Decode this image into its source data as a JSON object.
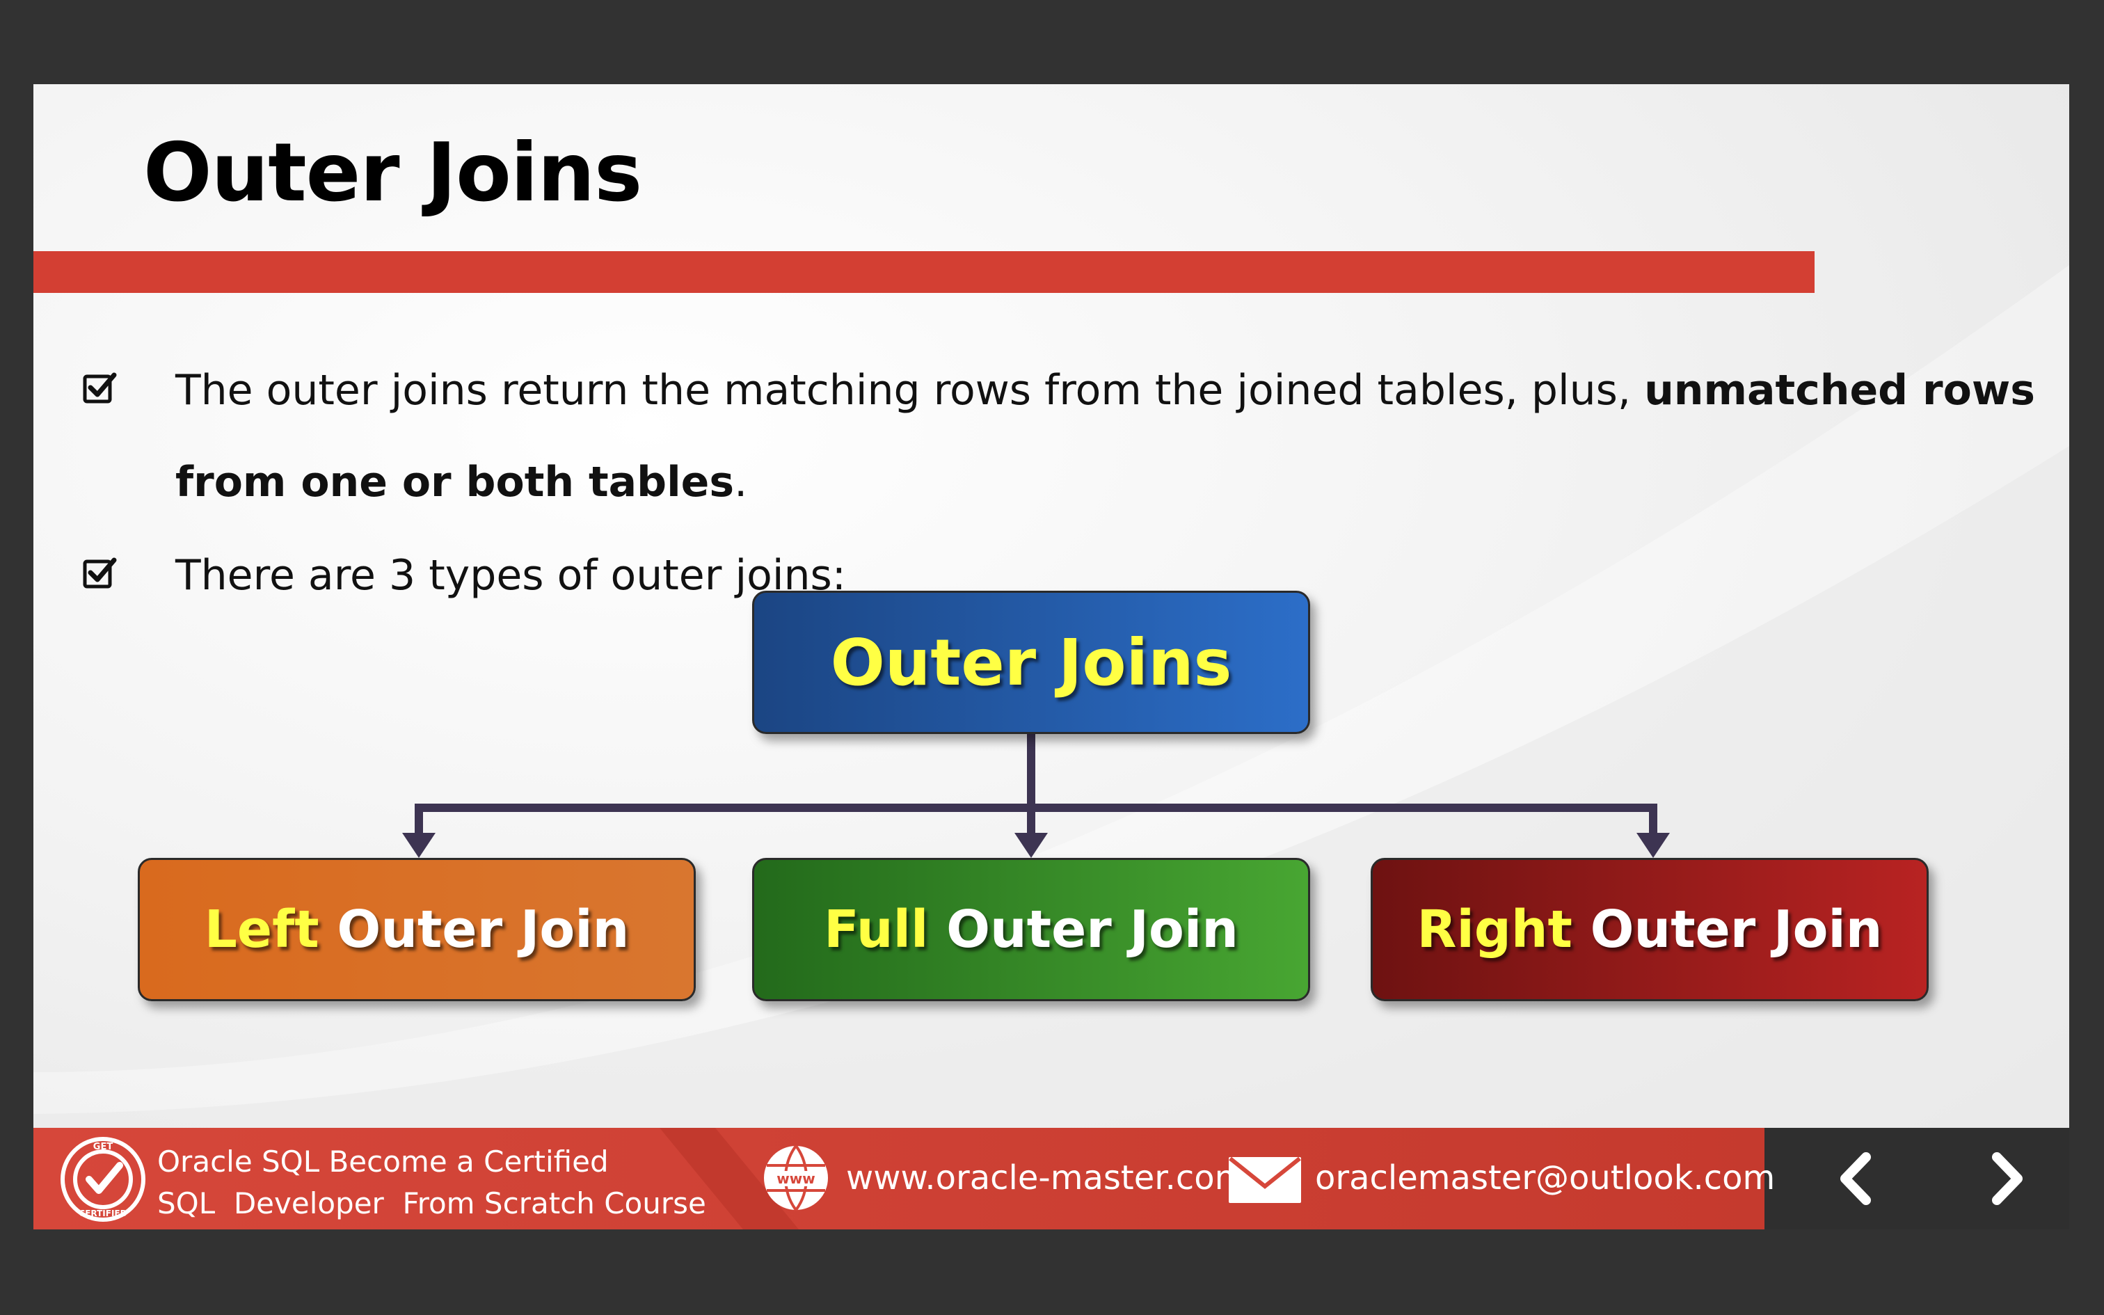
{
  "slide": {
    "title": "Outer Joins",
    "bullets": [
      {
        "line1_normal": "The outer joins return the matching rows from the joined tables, plus, ",
        "line1_bold": "unmatched rows",
        "line2_bold": "from one or both tables",
        "line2_normal": "."
      },
      {
        "text": "There are 3 types of outer joins:"
      }
    ],
    "diagram": {
      "root": "Outer Joins",
      "children": [
        {
          "highlight": "Left",
          "rest": " Outer Join",
          "color": "#d9712a"
        },
        {
          "highlight": "Full",
          "rest": " Outer Join",
          "color": "#369028"
        },
        {
          "highlight": "Right",
          "rest": " Outer Join",
          "color": "#a01b1a"
        }
      ]
    }
  },
  "footer": {
    "badge_top": "GET",
    "badge_bottom": "CERTIFIED",
    "course_line1": "Oracle SQL Become a Certified",
    "course_line2": "SQL  Developer  From Scratch Course",
    "website_icon_text": "www",
    "website": "www.oracle-master.com",
    "email": "oraclemaster@outlook.com"
  },
  "colors": {
    "accent_red": "#d33f33",
    "dark": "#2f2f2f",
    "highlight_yellow": "#ffff44"
  }
}
